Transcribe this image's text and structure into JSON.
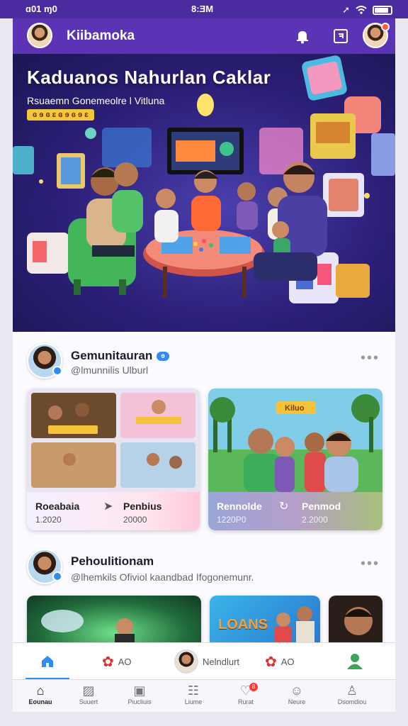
{
  "status": {
    "time_left": "ɑ01 ɱ0",
    "time_center": "8:ƎM",
    "battery_level": 0.85
  },
  "appbar": {
    "title": "Kiibamoka"
  },
  "hero": {
    "title": "Kaduanos  Nahurlan Caklar",
    "subtitle": "Rsuaemn Gonemeolre l Vitluna",
    "strip": "ɞ ɘ  ɞ   ɛ  ɞ ɘ   ɞ  ɘ   ɛ"
  },
  "post1": {
    "name": "Gemunitauran",
    "pill": "ɘ",
    "handle": "@lmunnilis Ulburl",
    "cards": [
      {
        "label": "Roeabaia",
        "value": "1.2020"
      },
      {
        "label": "Penbius",
        "value": "20000"
      },
      {
        "label": "Rennolde",
        "value": "1220P0"
      },
      {
        "label": "Penmod",
        "value": "2.2000"
      }
    ],
    "card_b_sign": "Kiluo"
  },
  "post2": {
    "name": "Pehoulitionam",
    "handle": "@lhemkils Ofiviol kaandbad Ifogonemunr."
  },
  "feed_strip": {
    "banner": "LOANS"
  },
  "tabs": [
    {
      "label": ""
    },
    {
      "label": "AO"
    },
    {
      "label": "Nelndlurt"
    },
    {
      "label": "AO"
    },
    {
      "label": ""
    }
  ],
  "nav": [
    {
      "label": "Eounau",
      "icon": "home-icon"
    },
    {
      "label": "Suuert",
      "icon": "image-icon"
    },
    {
      "label": "Piucliuis",
      "icon": "video-icon"
    },
    {
      "label": "Liume",
      "icon": "chat-icon"
    },
    {
      "label": "Rurat",
      "icon": "heart-icon",
      "badge": "8"
    },
    {
      "label": "Neure",
      "icon": "face-icon"
    },
    {
      "label": "Dsomdiou",
      "icon": "profile-icon"
    }
  ]
}
